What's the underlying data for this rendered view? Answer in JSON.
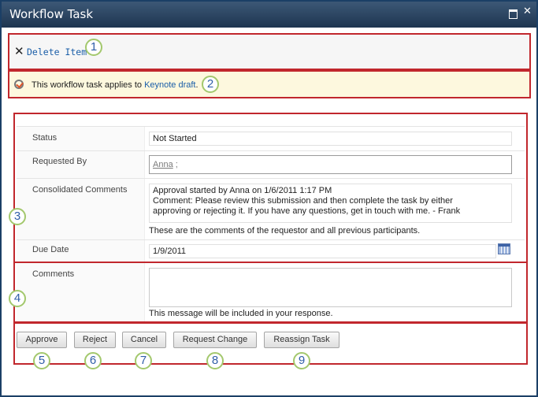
{
  "window": {
    "title": "Workflow Task",
    "controls": [
      "maximize-icon",
      "close-icon"
    ]
  },
  "ribbon": {
    "delete_icon": "x-icon",
    "delete_label": "Delete Item"
  },
  "notice": {
    "icon": "workflow-task-icon",
    "text_prefix": "This workflow task applies to ",
    "link_text": "Keynote draft",
    "text_suffix": "."
  },
  "form": {
    "status": {
      "label": "Status",
      "value": "Not Started"
    },
    "requested_by": {
      "label": "Requested By",
      "value": "Anna",
      "separator": ";"
    },
    "consolidated_comments": {
      "label": "Consolidated Comments",
      "lines": [
        "Approval started by Anna on 1/6/2011 1:17 PM",
        "Comment: Please review this submission and then complete the task by either",
        "approving or rejecting it. If you have any questions, get in touch with me. - Frank"
      ],
      "hint": "These are the comments of the requestor and all previous participants."
    },
    "due_date": {
      "label": "Due Date",
      "value": "1/9/2011",
      "icon": "calendar-icon"
    },
    "comments": {
      "label": "Comments",
      "value": "",
      "hint": "This message will be included in your response."
    }
  },
  "buttons": {
    "approve": "Approve",
    "reject": "Reject",
    "cancel": "Cancel",
    "request_change": "Request Change",
    "reassign_task": "Reassign Task"
  },
  "callouts": [
    "1",
    "2",
    "3",
    "4",
    "5",
    "6",
    "7",
    "8",
    "9"
  ],
  "colors": {
    "highlight_border": "#c1272d",
    "callout_border": "#a3c86d",
    "callout_text": "#2f5ea8",
    "link": "#1a5ea8",
    "titlebar": "#2a4562"
  }
}
